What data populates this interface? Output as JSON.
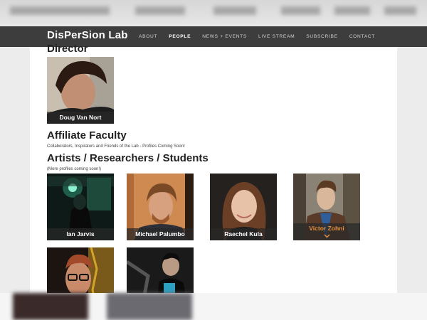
{
  "site": {
    "brand": "DisPerSion Lab"
  },
  "nav": [
    {
      "label": "About",
      "active": false
    },
    {
      "label": "People",
      "active": true
    },
    {
      "label": "News + Events",
      "active": false
    },
    {
      "label": "Live Stream",
      "active": false
    },
    {
      "label": "Subscribe",
      "active": false
    },
    {
      "label": "Contact",
      "active": false
    }
  ],
  "sections": {
    "director": {
      "heading": "Director",
      "people": [
        {
          "name": "Doug Van Nort"
        }
      ]
    },
    "affiliate": {
      "heading": "Affiliate Faculty",
      "note": "Collaborators, Inspirators and Friends of the Lab - Profiles Coming Soon!"
    },
    "artists": {
      "heading": "Artists / Researchers / Students",
      "note": "(More profiles coming soon!)",
      "people": [
        {
          "name": "Ian Jarvis"
        },
        {
          "name": "Michael Palumbo"
        },
        {
          "name": "Raechel Kula"
        },
        {
          "name": "Victor Zohni",
          "hover": true
        },
        {
          "name": ""
        },
        {
          "name": ""
        }
      ]
    }
  },
  "colors": {
    "navbar": "#3d3d3d",
    "accent": "#e8913a",
    "page": "#ffffff",
    "background": "#ececec"
  }
}
